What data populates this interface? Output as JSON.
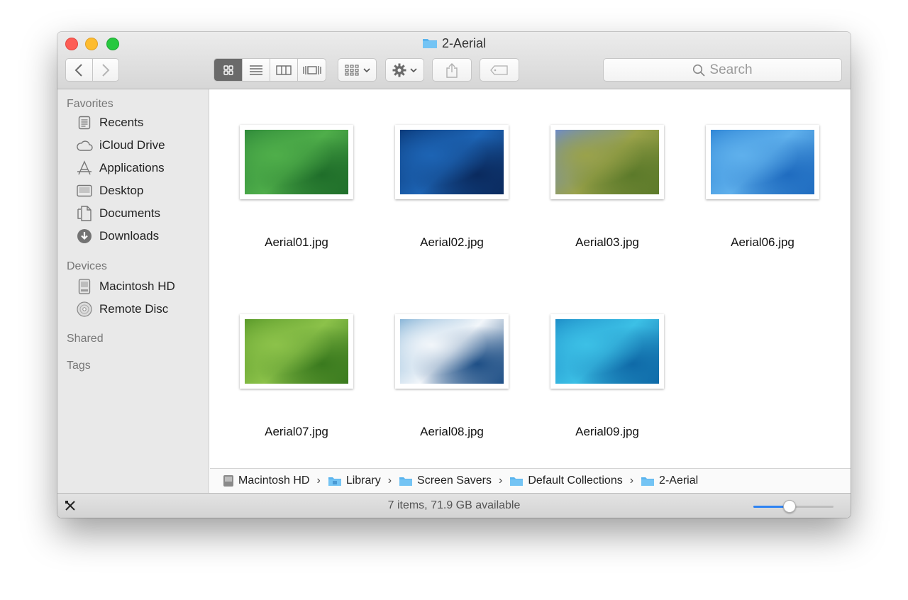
{
  "window": {
    "title": "2-Aerial"
  },
  "toolbar": {
    "back_icon": "chevron-left-icon",
    "forward_icon": "chevron-right-icon",
    "view_modes": [
      "icon-view",
      "list-view",
      "column-view",
      "cover-flow-view"
    ],
    "active_view": "icon-view",
    "arrange_icon": "arrange-grid-icon",
    "action_icon": "gear-icon",
    "share_icon": "share-icon",
    "tag_icon": "tag-icon",
    "search_placeholder": "Search"
  },
  "sidebar": {
    "favorites_heading": "Favorites",
    "favorites": [
      {
        "label": "Recents",
        "icon": "recents-icon"
      },
      {
        "label": "iCloud Drive",
        "icon": "cloud-icon"
      },
      {
        "label": "Applications",
        "icon": "applications-icon"
      },
      {
        "label": "Desktop",
        "icon": "desktop-icon"
      },
      {
        "label": "Documents",
        "icon": "documents-icon"
      },
      {
        "label": "Downloads",
        "icon": "downloads-icon"
      }
    ],
    "devices_heading": "Devices",
    "devices": [
      {
        "label": "Macintosh HD",
        "icon": "hard-drive-icon"
      },
      {
        "label": "Remote Disc",
        "icon": "disc-icon"
      }
    ],
    "shared_heading": "Shared",
    "tags_heading": "Tags"
  },
  "files": [
    {
      "name": "Aerial01.jpg",
      "colors": [
        "#2f8a3a",
        "#4fae4a",
        "#1f6e2a"
      ]
    },
    {
      "name": "Aerial02.jpg",
      "colors": [
        "#0b3a7a",
        "#1d64b4",
        "#0a2a5e"
      ]
    },
    {
      "name": "Aerial03.jpg",
      "colors": [
        "#6e8cc8",
        "#9aa24a",
        "#5c7a2a"
      ]
    },
    {
      "name": "Aerial06.jpg",
      "colors": [
        "#2f86d6",
        "#5fb0ec",
        "#1f6cc0"
      ]
    },
    {
      "name": "Aerial07.jpg",
      "colors": [
        "#5a9a2a",
        "#8cc24a",
        "#3a7a1e"
      ]
    },
    {
      "name": "Aerial08.jpg",
      "colors": [
        "#8ab6d8",
        "#f2f6fa",
        "#1e4f86"
      ]
    },
    {
      "name": "Aerial09.jpg",
      "colors": [
        "#1e8ec8",
        "#3cc0e6",
        "#0f6aa8"
      ]
    }
  ],
  "pathbar": [
    {
      "label": "Macintosh HD",
      "icon": "hard-drive-icon"
    },
    {
      "label": "Library",
      "icon": "folder-icon"
    },
    {
      "label": "Screen Savers",
      "icon": "folder-icon"
    },
    {
      "label": "Default Collections",
      "icon": "folder-icon"
    },
    {
      "label": "2-Aerial",
      "icon": "folder-icon"
    }
  ],
  "status": {
    "text": "7 items, 71.9 GB available",
    "left_icon": "tools-icon",
    "icon_size_level": 0.45
  },
  "colors": {
    "accent": "#2e83f2",
    "folder": "#5ab4ee"
  }
}
